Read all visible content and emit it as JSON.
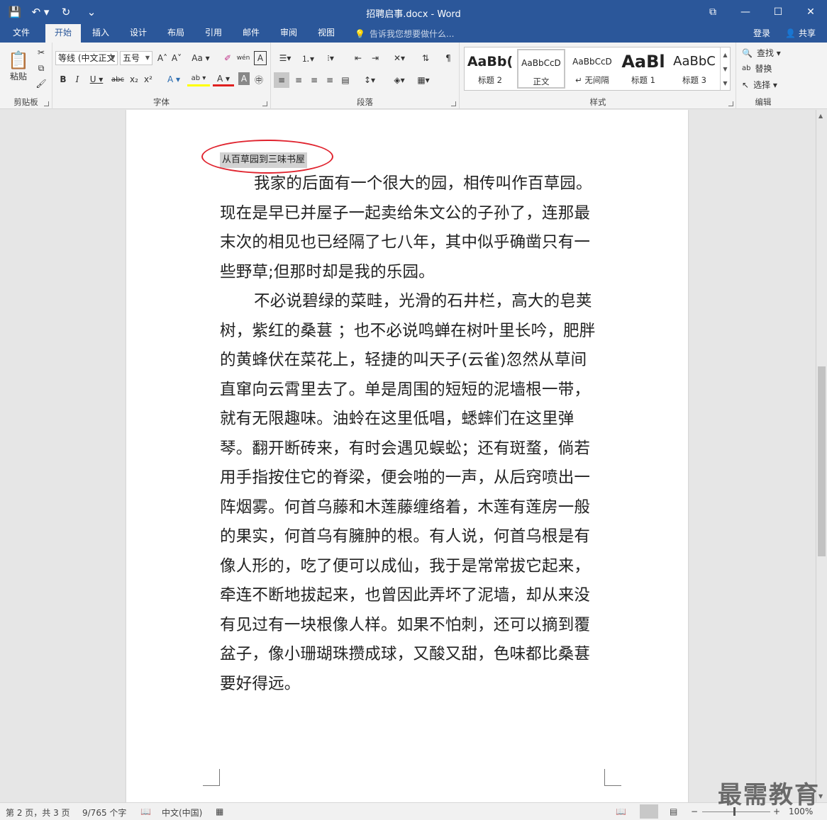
{
  "window": {
    "title": "招聘启事.docx - Word",
    "controls": {
      "ribbon_display": "⧉",
      "minimize": "—",
      "maximize": "☐",
      "close": "✕"
    }
  },
  "qat": {
    "save": "💾",
    "undo": "↶ ▾",
    "redo": "↻",
    "customize": "⌄"
  },
  "tabs": [
    {
      "label": "文件"
    },
    {
      "label": "开始"
    },
    {
      "label": "插入"
    },
    {
      "label": "设计"
    },
    {
      "label": "布局"
    },
    {
      "label": "引用"
    },
    {
      "label": "邮件"
    },
    {
      "label": "审阅"
    },
    {
      "label": "视图"
    }
  ],
  "tellme": {
    "placeholder": "告诉我您想要做什么..."
  },
  "account": {
    "login": "登录",
    "share": "共享"
  },
  "ribbon": {
    "clipboard": {
      "label": "剪贴板",
      "paste": "粘贴"
    },
    "font": {
      "label": "字体",
      "font_name": "等线 (中文正文",
      "font_size": "五号",
      "grow": "A˄",
      "shrink": "A˅",
      "case": "Aa ▾",
      "clear": "✐",
      "phonetic": "wén",
      "border": "A",
      "bold": "B",
      "italic": "I",
      "underline": "U ▾",
      "strike": "abc",
      "sub": "x₂",
      "sup": "x²",
      "effects": "A ▾",
      "highlight": "ab ▾",
      "color": "A ▾",
      "shading": "A",
      "enclose": "㊥"
    },
    "paragraph": {
      "label": "段落"
    },
    "styles": {
      "label": "样式",
      "items": [
        {
          "sample": "AaBb(",
          "name": "标题 2"
        },
        {
          "sample": "AaBbCcD",
          "name": "正文"
        },
        {
          "sample": "AaBbCcD",
          "name": "↵ 无间隔"
        },
        {
          "sample": "AaBl",
          "name": "标题 1"
        },
        {
          "sample": "AaBbC",
          "name": "标题 3"
        }
      ]
    },
    "editing": {
      "label": "编辑",
      "find": "查找 ▾",
      "replace": "替换",
      "select": "选择 ▾"
    }
  },
  "document": {
    "heading": "从百草园到三味书屋",
    "paragraphs": [
      "我家的后面有一个很大的园，相传叫作百草园。现在是早已并屋子一起卖给朱文公的子孙了，连那最末次的相见也已经隔了七八年，其中似乎确凿只有一些野草;但那时却是我的乐园。",
      "不必说碧绿的菜畦，光滑的石井栏，高大的皂荚树，紫红的桑葚 ；也不必说鸣蝉在树叶里长吟，肥胖的黄蜂伏在菜花上，轻捷的叫天子(云雀)忽然从草间直窜向云霄里去了。单是周围的短短的泥墙根一带，就有无限趣味。油蛉在这里低唱，蟋蟀们在这里弹琴。翻开断砖来，有时会遇见蜈蚣；还有斑蝥，倘若用手指按住它的脊梁，便会啪的一声，从后窍喷出一阵烟雾。何首乌藤和木莲藤缠络着，木莲有莲房一般的果实，何首乌有臃肿的根。有人说，何首乌根是有像人形的，吃了便可以成仙，我于是常常拔它起来，牵连不断地拔起来，也曾因此弄坏了泥墙，却从来没有见过有一块根像人样。如果不怕刺，还可以摘到覆盆子，像小珊瑚珠攒成球，又酸又甜，色味都比桑葚要好得远。"
    ]
  },
  "status": {
    "page": "第 2 页，共 3 页",
    "words": "9/765 个字",
    "language": "中文(中国)",
    "zoom": "100%"
  },
  "watermark": "最需教育"
}
